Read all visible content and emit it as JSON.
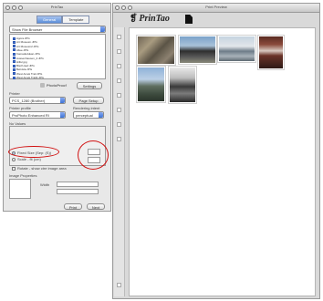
{
  "settings_window": {
    "title": "PrinTao",
    "tabs": [
      {
        "label": "General"
      },
      {
        "label": "Template"
      }
    ],
    "file_source": "Show File Browser",
    "files": [
      "Agora.JPG",
      "Art Museum.JPG",
      "Art Museum2.JPG",
      "Allee.JPG",
      "Kamadudukan.JPG",
      "Aussenhausen_2.JPG",
      "Hilfer.jpg",
      "Bisch-lauf.JPG",
      "Belvista.JPG",
      "West Amek Trail.JPG",
      "West Amek Trail2.JPG"
    ],
    "photofinish_label": "PhotoProof",
    "settings_button": "Settings",
    "printer_label": "Printer",
    "printer_value": "PCS_1280 (Brother)",
    "page_setup_button": "Page Setup",
    "printer_profile_label": "Printer profile",
    "printer_profile_value": "ProPhoto Enhanced RI",
    "rendering_intent_label": "Rendering intent",
    "rendering_intent_value": "perceptual",
    "no_values_label": "No Values",
    "option_fixed_size": "Fixed Size  (Sep: (S))",
    "option_scale": "Scale - fit (cm)",
    "option_rotate": "Rotate - show ctre image area",
    "image_properties_label": "Image Properties",
    "width_label": "Width",
    "stepper_top": "",
    "stepper_bottom": "",
    "preview_button": "Print",
    "print_button": "Next"
  },
  "preview_window": {
    "title": "Print Preview",
    "logo_text": "PrinTao",
    "toolbar_tools": [
      "zoom-in",
      "zoom-out",
      "rotate",
      "grid",
      "crop",
      "move",
      "fit",
      "info",
      "marker",
      "print"
    ]
  },
  "colors": {
    "annotation_red": "#d11212",
    "selection_blue": "#3d74d7",
    "window_gray": "#e8e8e8"
  }
}
